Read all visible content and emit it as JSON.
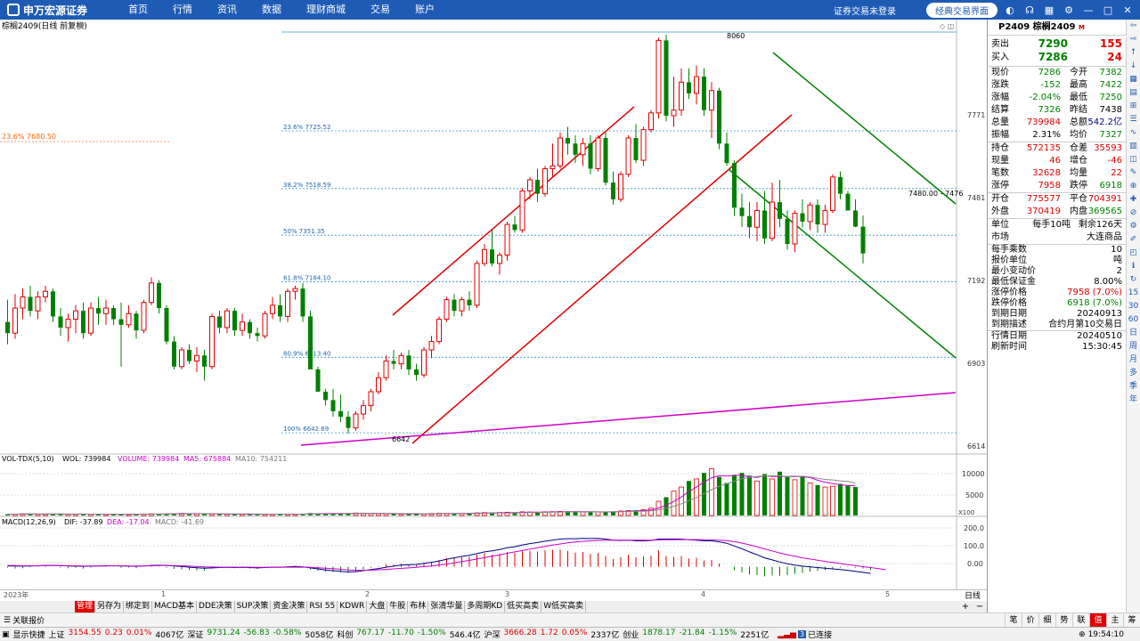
{
  "topbar": {
    "logo": "申万宏源证券",
    "nav": [
      "首页",
      "行情",
      "资讯",
      "数据",
      "理财商城",
      "交易",
      "账户"
    ],
    "login_status": "证券交易未登录",
    "classic_button": "经典交易界面"
  },
  "chart": {
    "title": "棕榈2409(日线 前复权)",
    "price_axis": [
      "7771",
      "7481",
      "7192",
      "6903",
      "6614"
    ],
    "fib_levels": [
      {
        "label": "23.6% 7725.52",
        "price": 7725.52
      },
      {
        "label": "38.2% 7518.59",
        "price": 7518.59
      },
      {
        "label": "50% 7351.35",
        "price": 7351.35
      },
      {
        "label": "61.8% 7184.10",
        "price": 7184.1
      },
      {
        "label": "80.9% 6913.40",
        "price": 6913.4
      },
      {
        "label": "100% 6642.69",
        "price": 6642.69
      }
    ],
    "left_fib_label": "23.6% 7680.50",
    "high_label": "8060",
    "low_label": "6642",
    "price_tag": "7480.00 - 7476",
    "vol_header": {
      "name": "VOL-TDX(5,10)",
      "wol": "WOL: 739984",
      "volume": "VOLUME: 739984",
      "ma5": "MA5: 675884",
      "ma10": "MA10: 754211"
    },
    "vol_axis": [
      "10000",
      "5000"
    ],
    "vol_unit": "X100",
    "macd_header": {
      "name": "MACD(12,26,9)",
      "dif": "DIF: -37.89",
      "dea": "DEA: -17.04",
      "macd": "MACD: -41.69"
    },
    "macd_axis": [
      "200.0",
      "100.0",
      "0.00"
    ],
    "period_axis": [
      "2023年",
      "1",
      "2",
      "3",
      "4",
      "5"
    ]
  },
  "panel": {
    "code": "P2409",
    "name": "棕榈2409",
    "mark": "M",
    "sell": {
      "label": "卖出",
      "price": "7290",
      "vol": "155"
    },
    "buy": {
      "label": "买入",
      "price": "7286",
      "vol": "24"
    },
    "quote_rows": [
      {
        "l1": "现价",
        "v1": "7286",
        "c1": "green",
        "l2": "今开",
        "v2": "7382",
        "c2": "green"
      },
      {
        "l1": "涨跌",
        "v1": "-152",
        "c1": "green",
        "l2": "最高",
        "v2": "7422",
        "c2": "green"
      },
      {
        "l1": "涨幅",
        "v1": "-2.04%",
        "c1": "green",
        "l2": "最低",
        "v2": "7250",
        "c2": "green"
      },
      {
        "l1": "结算",
        "v1": "7326",
        "c1": "green",
        "l2": "昨结",
        "v2": "7438",
        "c2": "black"
      },
      {
        "l1": "总量",
        "v1": "739984",
        "c1": "red",
        "l2": "总额",
        "v2": "542.2亿",
        "c2": "dblue"
      },
      {
        "l1": "振幅",
        "v1": "2.31%",
        "c1": "black",
        "l2": "均价",
        "v2": "7327",
        "c2": "green"
      }
    ],
    "pos_rows": [
      {
        "l1": "持仓",
        "v1": "572135",
        "c1": "red",
        "l2": "仓差",
        "v2": "35593",
        "c2": "red"
      },
      {
        "l1": "现量",
        "v1": "46",
        "c1": "red",
        "l2": "增仓",
        "v2": "-46",
        "c2": "red"
      },
      {
        "l1": "笔数",
        "v1": "32628",
        "c1": "red",
        "l2": "均量",
        "v2": "22",
        "c2": "red"
      },
      {
        "l1": "涨停",
        "v1": "7958",
        "c1": "red",
        "l2": "跌停",
        "v2": "6918",
        "c2": "green"
      }
    ],
    "open_rows": [
      {
        "l1": "开仓",
        "v1": "775577",
        "c1": "red",
        "l2": "平仓",
        "v2": "704391",
        "c2": "red"
      },
      {
        "l1": "外盘",
        "v1": "370419",
        "c1": "red",
        "l2": "内盘",
        "v2": "369565",
        "c2": "green"
      }
    ],
    "unit": {
      "l": "单位",
      "v1": "每手10吨",
      "v2": "剩余126天"
    },
    "market": {
      "l": "市场",
      "v": "大连商品"
    },
    "details": [
      {
        "k": "每手乘数",
        "v": "10",
        "c": "black"
      },
      {
        "k": "报价单位",
        "v": "吨",
        "c": "black"
      },
      {
        "k": "最小变动价",
        "v": "2",
        "c": "black"
      },
      {
        "k": "最低保证金",
        "v": "8.00%",
        "c": "black"
      },
      {
        "k": "涨停价格",
        "v": "7958 (7.0%)",
        "c": "red"
      },
      {
        "k": "跌停价格",
        "v": "6918 (7.0%)",
        "c": "green"
      },
      {
        "k": "到期日期",
        "v": "20240913",
        "c": "black"
      },
      {
        "k": "到期描述",
        "v": "合约月第10交易日",
        "c": "black"
      }
    ],
    "trade_date": {
      "k": "行情日期",
      "v": "20240510"
    },
    "refresh_time": {
      "k": "刷新时间",
      "v": "15:30:45"
    }
  },
  "right_tools": [
    "⇦",
    "⇨",
    "↑",
    "↓",
    "▦",
    "▤",
    "⊞",
    "☰",
    "∿",
    "▥",
    "◫",
    "✎",
    "⊕",
    "✚",
    "⊘",
    "⚙",
    "✐",
    "◰",
    "ℹ",
    "↻",
    "15",
    "30",
    "60",
    "日",
    "周",
    "月",
    "多",
    "季",
    "年"
  ],
  "period_label": "日线",
  "tabs": [
    "管理",
    "另存为",
    "绑定到",
    "MACD基本",
    "DDE决策",
    "SUP决策",
    "资金决策",
    "RSI 55",
    "KDWR",
    "大盘",
    "牛股",
    "布林",
    "张清华量",
    "多周期KD",
    "低买高卖",
    "W低买高卖"
  ],
  "ask_button": "关联报价",
  "bottom_tabs": [
    "笔",
    "价",
    "细",
    "势",
    "联",
    "值",
    "主",
    "筹"
  ],
  "status": {
    "show_quick": "显示快捷",
    "indices": [
      {
        "name": "上证",
        "price": "3154.55",
        "chg": "0.23",
        "pct": "0.01%",
        "amt": "4067亿",
        "cls": "red"
      },
      {
        "name": "深证",
        "price": "9731.24",
        "chg": "-56.83",
        "pct": "-0.58%",
        "amt": "5058亿",
        "cls": "green"
      },
      {
        "name": "科创",
        "price": "767.17",
        "chg": "-11.70",
        "pct": "-1.50%",
        "amt": "546.4亿",
        "cls": "green"
      },
      {
        "name": "沪深",
        "price": "3666.28",
        "chg": "1.72",
        "pct": "0.05%",
        "amt": "2337亿",
        "cls": "red"
      },
      {
        "name": "创业",
        "price": "1878.17",
        "chg": "-21.84",
        "pct": "-1.15%",
        "amt": "2251亿",
        "cls": "green"
      }
    ],
    "conn_badge": "3",
    "connected": "已连接",
    "clock": "19:54:10"
  },
  "colors": {
    "up": "#e00000",
    "down": "#008000",
    "accent": "#1e5bb5",
    "fib": "#3399cc"
  },
  "chart_data": {
    "type": "candlestick",
    "ohlc": [
      [
        7040,
        7120,
        6960,
        7000
      ],
      [
        7000,
        7140,
        6980,
        7090
      ],
      [
        7090,
        7160,
        7050,
        7130
      ],
      [
        7130,
        7170,
        7060,
        7080
      ],
      [
        7080,
        7150,
        7050,
        7130
      ],
      [
        7130,
        7170,
        7110,
        7150
      ],
      [
        7150,
        7160,
        7040,
        7060
      ],
      [
        7060,
        7090,
        6990,
        7020
      ],
      [
        7020,
        7070,
        6970,
        7050
      ],
      [
        7050,
        7100,
        7000,
        7080
      ],
      [
        7080,
        7110,
        6980,
        7000
      ],
      [
        7000,
        7110,
        6990,
        7090
      ],
      [
        7090,
        7130,
        7030,
        7070
      ],
      [
        7070,
        7120,
        7030,
        7090
      ],
      [
        7090,
        7100,
        7030,
        7050
      ],
      [
        7050,
        7110,
        6880,
        7030
      ],
      [
        7030,
        7100,
        7020,
        7070
      ],
      [
        7070,
        7080,
        6980,
        7010
      ],
      [
        7010,
        7120,
        7000,
        7110
      ],
      [
        7110,
        7200,
        7100,
        7180
      ],
      [
        7180,
        7190,
        7070,
        7090
      ],
      [
        7090,
        7100,
        6960,
        6970
      ],
      [
        6970,
        6990,
        6870,
        6880
      ],
      [
        6880,
        6950,
        6870,
        6940
      ],
      [
        6940,
        6960,
        6890,
        6900
      ],
      [
        6900,
        6950,
        6860,
        6920
      ],
      [
        6920,
        6940,
        6830,
        6880
      ],
      [
        6880,
        7070,
        6870,
        7060
      ],
      [
        7060,
        7080,
        7000,
        7020
      ],
      [
        7020,
        7090,
        7000,
        7080
      ],
      [
        7080,
        7090,
        6990,
        7010
      ],
      [
        7010,
        7070,
        6990,
        7040
      ],
      [
        7040,
        7050,
        6980,
        7000
      ],
      [
        7000,
        7020,
        6970,
        6990
      ],
      [
        6990,
        7080,
        6980,
        7070
      ],
      [
        7070,
        7130,
        7050,
        7100
      ],
      [
        7100,
        7140,
        7040,
        7060
      ],
      [
        7060,
        7160,
        7040,
        7150
      ],
      [
        7150,
        7170,
        7120,
        7160
      ],
      [
        7160,
        7180,
        7040,
        7060
      ],
      [
        7060,
        7080,
        6880,
        6870
      ],
      [
        6870,
        6880,
        6800,
        6790
      ],
      [
        6790,
        6800,
        6740,
        6760
      ],
      [
        6760,
        6800,
        6700,
        6720
      ],
      [
        6720,
        6780,
        6680,
        6700
      ],
      [
        6700,
        6720,
        6640,
        6660
      ],
      [
        6660,
        6720,
        6650,
        6710
      ],
      [
        6710,
        6760,
        6690,
        6740
      ],
      [
        6740,
        6800,
        6720,
        6790
      ],
      [
        6790,
        6860,
        6780,
        6840
      ],
      [
        6840,
        6920,
        6830,
        6900
      ],
      [
        6900,
        6940,
        6870,
        6890
      ],
      [
        6890,
        6930,
        6870,
        6920
      ],
      [
        6920,
        6940,
        6850,
        6870
      ],
      [
        6870,
        6890,
        6830,
        6850
      ],
      [
        6850,
        6950,
        6840,
        6940
      ],
      [
        6940,
        6990,
        6910,
        6970
      ],
      [
        6970,
        7060,
        6960,
        7050
      ],
      [
        7050,
        7130,
        7040,
        7120
      ],
      [
        7120,
        7140,
        7060,
        7080
      ],
      [
        7080,
        7130,
        7060,
        7120
      ],
      [
        7120,
        7150,
        7080,
        7100
      ],
      [
        7100,
        7260,
        7090,
        7250
      ],
      [
        7250,
        7320,
        7240,
        7300
      ],
      [
        7300,
        7370,
        7240,
        7250
      ],
      [
        7250,
        7290,
        7210,
        7280
      ],
      [
        7280,
        7400,
        7260,
        7390
      ],
      [
        7390,
        7420,
        7360,
        7370
      ],
      [
        7370,
        7520,
        7360,
        7510
      ],
      [
        7510,
        7560,
        7480,
        7550
      ],
      [
        7550,
        7590,
        7470,
        7500
      ],
      [
        7500,
        7600,
        7490,
        7590
      ],
      [
        7590,
        7680,
        7560,
        7600
      ],
      [
        7600,
        7720,
        7590,
        7700
      ],
      [
        7700,
        7740,
        7640,
        7680
      ],
      [
        7680,
        7710,
        7610,
        7640
      ],
      [
        7640,
        7700,
        7600,
        7680
      ],
      [
        7680,
        7710,
        7570,
        7590
      ],
      [
        7590,
        7710,
        7580,
        7700
      ],
      [
        7700,
        7720,
        7530,
        7540
      ],
      [
        7540,
        7580,
        7460,
        7480
      ],
      [
        7480,
        7580,
        7470,
        7570
      ],
      [
        7570,
        7710,
        7560,
        7700
      ],
      [
        7700,
        7750,
        7610,
        7620
      ],
      [
        7620,
        7740,
        7600,
        7730
      ],
      [
        7730,
        7800,
        7720,
        7790
      ],
      [
        7790,
        8060,
        7770,
        8050
      ],
      [
        8050,
        8070,
        7760,
        7780
      ],
      [
        7780,
        7920,
        7740,
        7800
      ],
      [
        7800,
        7950,
        7780,
        7900
      ],
      [
        7900,
        7950,
        7840,
        7860
      ],
      [
        7860,
        7960,
        7820,
        7920
      ],
      [
        7920,
        7950,
        7780,
        7800
      ],
      [
        7800,
        7900,
        7700,
        7870
      ],
      [
        7870,
        7880,
        7660,
        7680
      ],
      [
        7680,
        7720,
        7600,
        7610
      ],
      [
        7610,
        7620,
        7420,
        7450
      ],
      [
        7450,
        7500,
        7380,
        7420
      ],
      [
        7420,
        7470,
        7340,
        7380
      ],
      [
        7380,
        7470,
        7330,
        7440
      ],
      [
        7440,
        7510,
        7320,
        7340
      ],
      [
        7340,
        7540,
        7330,
        7470
      ],
      [
        7470,
        7550,
        7380,
        7410
      ],
      [
        7410,
        7440,
        7300,
        7320
      ],
      [
        7320,
        7440,
        7290,
        7430
      ],
      [
        7430,
        7480,
        7380,
        7400
      ],
      [
        7400,
        7470,
        7370,
        7460
      ],
      [
        7460,
        7480,
        7360,
        7390
      ],
      [
        7390,
        7460,
        7360,
        7440
      ],
      [
        7440,
        7570,
        7430,
        7560
      ],
      [
        7560,
        7580,
        7480,
        7500
      ],
      [
        7500,
        7510,
        7440,
        7440
      ],
      [
        7440,
        7480,
        7380,
        7382
      ],
      [
        7382,
        7422,
        7250,
        7286
      ]
    ],
    "volume": [
      300,
      350,
      420,
      380,
      310,
      290,
      350,
      400,
      320,
      300,
      280,
      310,
      330,
      290,
      350,
      300,
      280,
      320,
      360,
      420,
      380,
      450,
      480,
      520,
      400,
      450,
      380,
      350,
      300,
      320,
      340,
      310,
      280,
      300,
      350,
      320,
      340,
      300,
      280,
      450,
      600,
      520,
      480,
      400,
      450,
      520,
      600,
      580,
      500,
      450,
      420,
      380,
      350,
      320,
      400,
      450,
      500,
      550,
      520,
      480,
      500,
      600,
      650,
      700,
      680,
      720,
      800,
      750,
      900,
      850,
      800,
      900,
      950,
      1000,
      1050,
      900,
      850,
      800,
      900,
      950,
      1000,
      1100,
      1200,
      1300,
      1400,
      1800,
      3500,
      4500,
      6000,
      7000,
      8500,
      9000,
      10500,
      11500,
      9500,
      8000,
      10000,
      10500,
      9800,
      8500,
      10200,
      9000,
      10800,
      9500,
      8800,
      9600,
      8000,
      7500,
      7000,
      7200,
      7800,
      7400,
      7000
    ],
    "macd": [
      -5,
      -10,
      -8,
      -3,
      2,
      5,
      0,
      -5,
      -8,
      -6,
      -10,
      -4,
      0,
      2,
      -2,
      -6,
      -4,
      -8,
      0,
      5,
      2,
      -5,
      -12,
      -15,
      -18,
      -20,
      -22,
      -10,
      -6,
      -4,
      -8,
      -6,
      -10,
      -12,
      -5,
      0,
      -2,
      3,
      5,
      -3,
      -15,
      -22,
      -28,
      -30,
      -32,
      -33,
      -25,
      -15,
      -5,
      5,
      15,
      12,
      18,
      14,
      10,
      20,
      28,
      38,
      50,
      52,
      55,
      58,
      70,
      80,
      70,
      75,
      85,
      80,
      90,
      92,
      88,
      95,
      98,
      100,
      92,
      82,
      85,
      74,
      80,
      62,
      45,
      55,
      70,
      55,
      60,
      65,
      95,
      62,
      58,
      62,
      48,
      52,
      36,
      40,
      18,
      0,
      -20,
      -32,
      -45,
      -48,
      -55,
      -50,
      -52,
      -48,
      -40,
      -35,
      -28,
      -22,
      -18,
      -10,
      -5,
      -2,
      -5,
      -10,
      -20
    ],
    "dif": [
      5,
      5,
      4,
      5,
      6,
      8,
      8,
      7,
      5,
      4,
      3,
      4,
      5,
      6,
      6,
      5,
      4,
      3,
      5,
      8,
      9,
      8,
      5,
      2,
      -2,
      -5,
      -8,
      -6,
      -4,
      -3,
      -4,
      -3,
      -4,
      -6,
      -4,
      -2,
      -2,
      0,
      2,
      0,
      -6,
      -12,
      -18,
      -22,
      -26,
      -30,
      -28,
      -22,
      -16,
      -10,
      -2,
      4,
      10,
      12,
      14,
      20,
      26,
      34,
      44,
      52,
      60,
      66,
      76,
      86,
      92,
      100,
      110,
      116,
      126,
      134,
      140,
      148,
      154,
      160,
      162,
      162,
      164,
      163,
      164,
      160,
      154,
      152,
      154,
      150,
      150,
      152,
      160,
      160,
      160,
      160,
      156,
      154,
      150,
      150,
      144,
      136,
      120,
      104,
      86,
      70,
      52,
      40,
      28,
      18,
      10,
      4,
      0,
      -4,
      -8,
      -12,
      -16,
      -20,
      -26,
      -32,
      -38
    ],
    "dea": [
      8,
      7,
      6,
      6,
      6,
      7,
      7,
      7,
      6,
      6,
      5,
      5,
      5,
      5,
      6,
      6,
      5,
      5,
      5,
      6,
      7,
      7,
      7,
      6,
      4,
      2,
      0,
      -1,
      -2,
      -2,
      -2,
      -2,
      -2,
      -3,
      -3,
      -3,
      -3,
      -2,
      -2,
      -2,
      -3,
      -5,
      -8,
      -11,
      -14,
      -18,
      -20,
      -20,
      -19,
      -17,
      -15,
      -12,
      -9,
      -6,
      -3,
      1,
      5,
      10,
      16,
      23,
      30,
      37,
      45,
      53,
      61,
      69,
      78,
      86,
      94,
      102,
      110,
      118,
      125,
      132,
      138,
      143,
      147,
      150,
      152,
      154,
      154,
      154,
      154,
      154,
      154,
      154,
      155,
      156,
      156,
      157,
      157,
      157,
      156,
      155,
      154,
      151,
      145,
      137,
      127,
      116,
      103,
      92,
      80,
      70,
      61,
      52,
      45,
      38,
      31,
      25,
      19,
      13,
      7,
      1,
      -4,
      -10,
      -17
    ],
    "fib_prices": [
      7725.52,
      7518.59,
      7351.35,
      7184.1,
      6913.4,
      6642.69
    ],
    "price_range": [
      6560,
      8080
    ],
    "volume_range": [
      0,
      12500
    ],
    "macd_range": [
      -130,
      250
    ]
  }
}
